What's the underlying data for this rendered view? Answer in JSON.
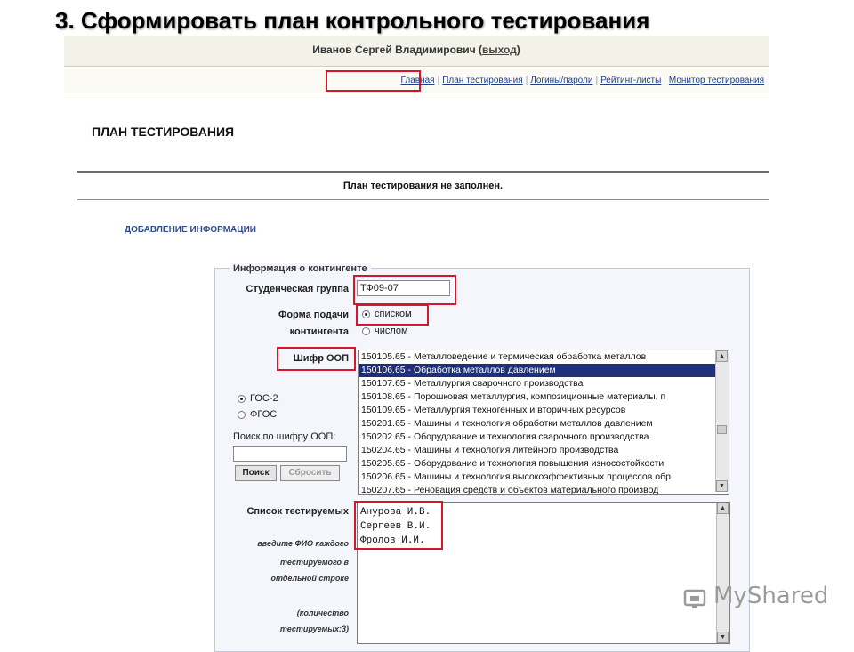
{
  "slide": {
    "title": "3. Сформировать план контрольного тестирования"
  },
  "header": {
    "user": "Иванов Сергей Владимирович",
    "logout_open": "(",
    "logout": "выход",
    "logout_close": ")"
  },
  "nav": {
    "items": [
      {
        "label": "Главная"
      },
      {
        "label": "План тестирования"
      },
      {
        "label": "Логины/пароли"
      },
      {
        "label": "Рейтинг-листы"
      },
      {
        "label": "Монитор тестирования"
      }
    ],
    "separator": "|"
  },
  "page": {
    "heading": "ПЛАН ТЕСТИРОВАНИЯ",
    "status": "План тестирования не заполнен.",
    "add_info": "ДОБАВЛЕНИЕ ИНФОРМАЦИИ"
  },
  "form": {
    "legend": "Информация о контингенте",
    "group_label": "Студенческая группа",
    "group_value": "ТФ09-07",
    "form_label_1": "Форма подачи",
    "form_label_2": "контингента",
    "form_option_list": "списком",
    "form_option_count": "числом",
    "form_selected": "списком",
    "oop_label": "Шифр ООП",
    "standard_gos": "ГОС-2",
    "standard_fgos": "ФГОС",
    "standard_selected": "ГОС-2",
    "search_label": "Поиск по шифру ООП:",
    "search_value": "",
    "search_button": "Поиск",
    "reset_button": "Сбросить",
    "oop_options": [
      "150105.65 - Металловедение и термическая обработка металлов",
      "150106.65 - Обработка металлов давлением",
      "150107.65 - Металлургия сварочного производства",
      "150108.65 - Порошковая металлургия, композиционные материалы, п",
      "150109.65 - Металлургия техногенных и вторичных ресурсов",
      "150201.65 - Машины и технология обработки металлов давлением",
      "150202.65 - Оборудование и технология сварочного производства",
      "150204.65 - Машины и технология литейного производства",
      "150205.65 - Оборудование и технология повышения износостойкости",
      "150206.65 - Машины и технология высокоэффективных процессов обр",
      "150207.65 - Реновация средств и объектов материального производ"
    ],
    "oop_selected_index": 1,
    "testees_label": "Список тестируемых",
    "testees_hint_1": "введите ФИО каждого",
    "testees_hint_2": "тестируемого в",
    "testees_hint_3": "отдельной строке",
    "testees_count_1": "(количество",
    "testees_count_2": "тестируемых:3)",
    "testees": [
      "Анурова И.В.",
      "Сергеев В.И.",
      "Фролов И.И."
    ]
  },
  "watermark": {
    "text": "MyShared"
  },
  "colors": {
    "highlight": "#d6162a",
    "selection": "#1f2f7a",
    "link": "#1f3f86"
  }
}
